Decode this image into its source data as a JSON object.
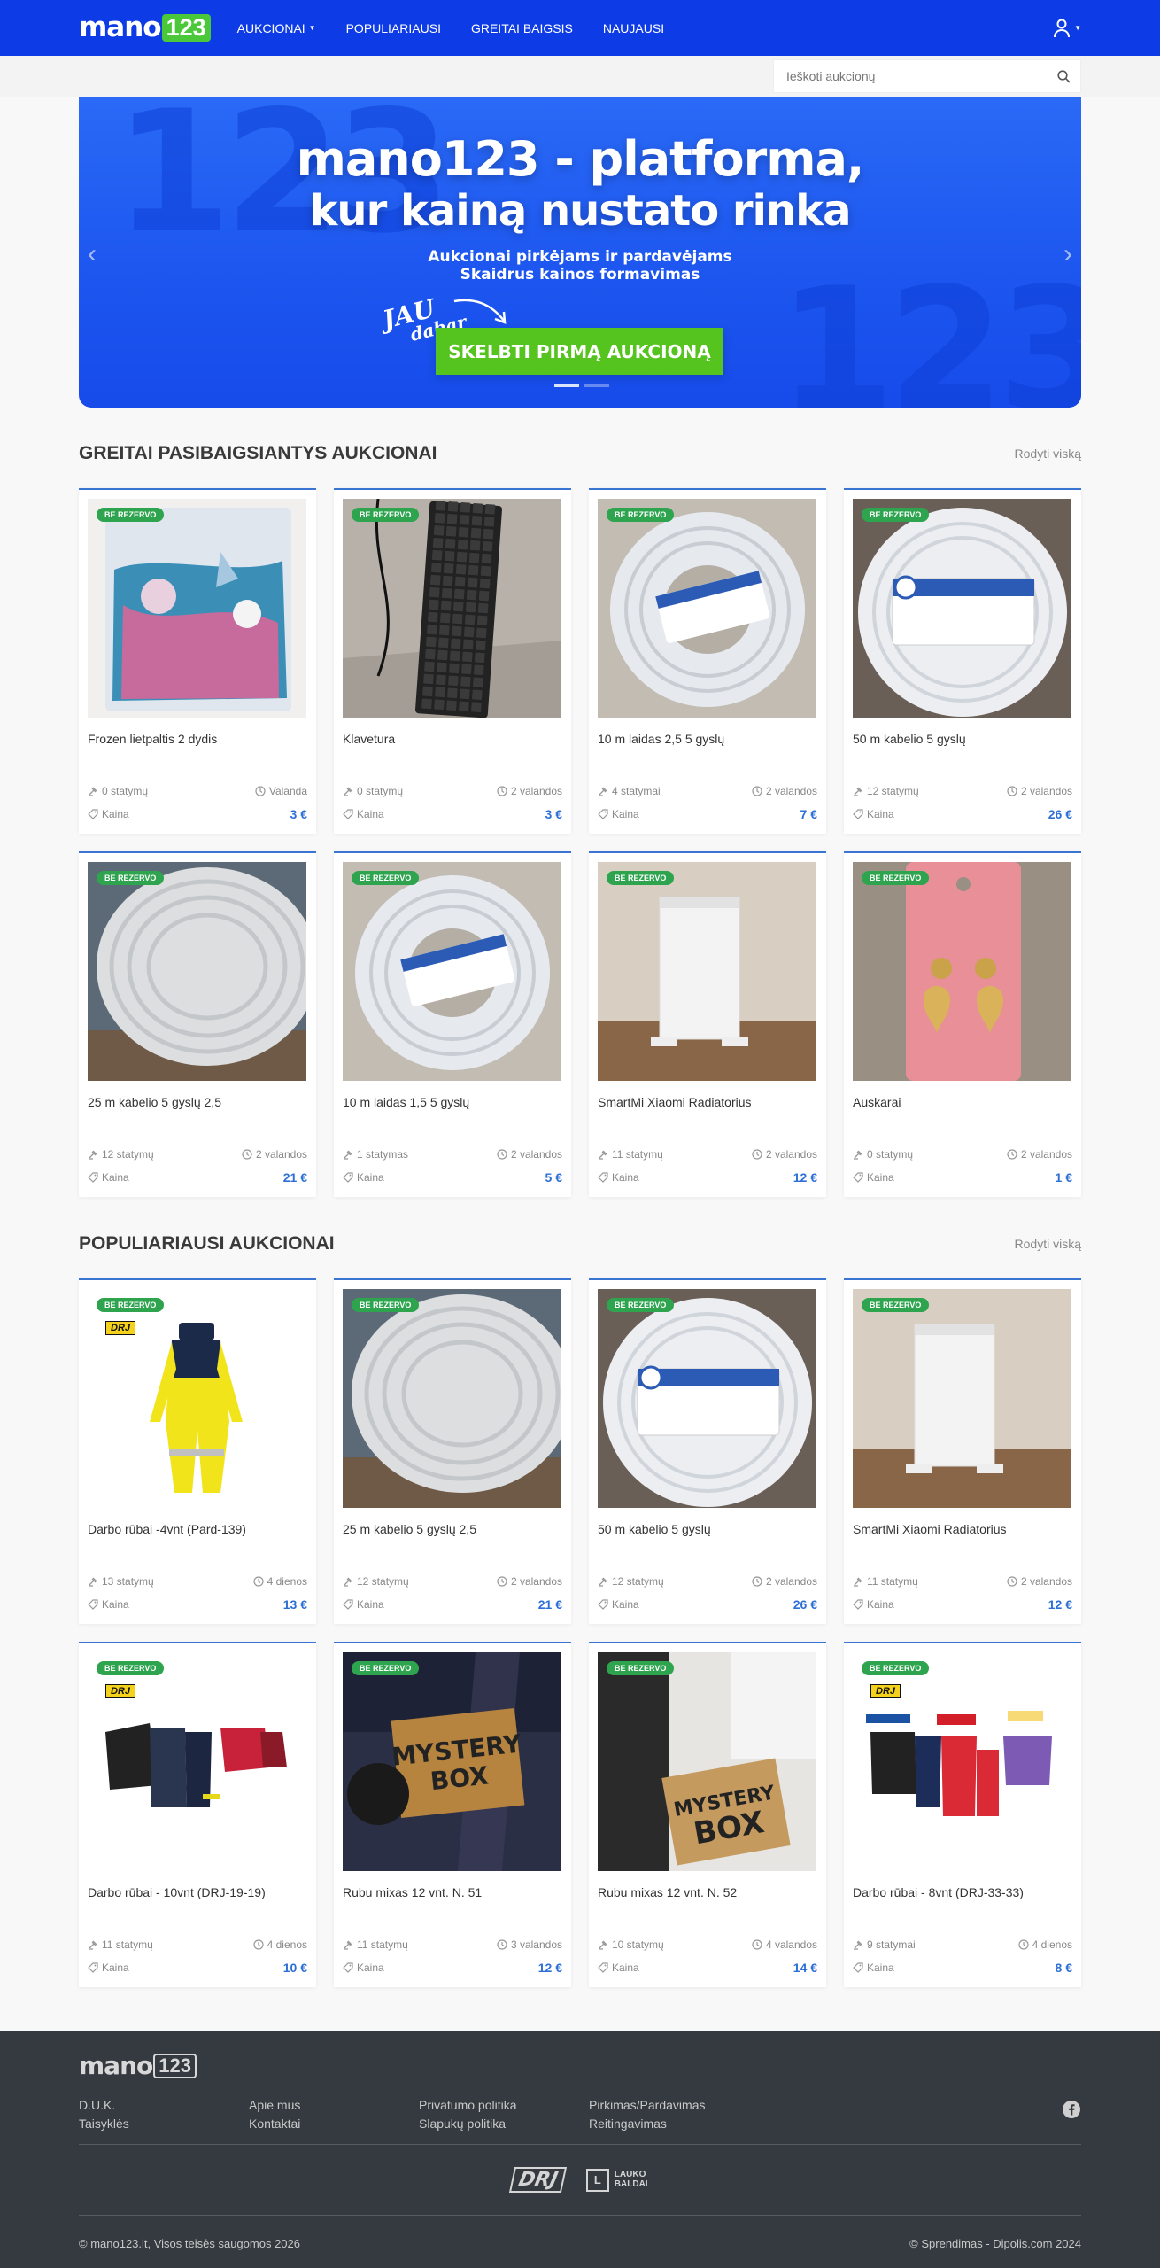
{
  "nav": {
    "logo_word": "mano",
    "logo_num": "123",
    "links": [
      "AUKCIONAI",
      "POPULIARIAUSI",
      "GREITAI BAIGSIS",
      "NAUJAUSI"
    ]
  },
  "search": {
    "placeholder": "Ieškoti aukcionų"
  },
  "hero": {
    "title_line1": "mano123 - platforma,",
    "title_line2": "kur kainą nustato rinka",
    "sub_line1": "Aukcionai pirkėjams ir pardavėjams",
    "sub_line2": "Skaidrus kainos formavimas",
    "script_line1": "JAU",
    "script_line2": "dabar",
    "cta": "SKELBTI PIRMĄ AUKCIONĄ",
    "bg_number": "123",
    "slide_active": 1
  },
  "badge_label": "BE REZERVO",
  "price_label": "Kaina",
  "sections": [
    {
      "title": "GREITAI PASIBAIGSIANTYS AUKCIONAI",
      "link": "Rodyti viską",
      "items": [
        {
          "title": "Frozen lietpaltis 2 dydis",
          "bids": "0 statymų",
          "time": "Valanda",
          "price": "3 €",
          "img": "frozen"
        },
        {
          "title": "Klavetura",
          "bids": "0 statymų",
          "time": "2 valandos",
          "price": "3 €",
          "img": "keyboard"
        },
        {
          "title": "10 m laidas 2,5 5 gyslų",
          "bids": "4 statymai",
          "time": "2 valandos",
          "price": "7 €",
          "img": "cable-blue"
        },
        {
          "title": "50 m kabelio 5 gyslų",
          "bids": "12 statymų",
          "time": "2 valandos",
          "price": "26 €",
          "img": "cable-white"
        },
        {
          "title": "25 m kabelio 5 gyslų 2,5",
          "bids": "12 statymų",
          "time": "2 valandos",
          "price": "21 €",
          "img": "cable-wrap"
        },
        {
          "title": "10 m laidas 1,5 5 gyslų",
          "bids": "1 statymas",
          "time": "2 valandos",
          "price": "5 €",
          "img": "cable-blue"
        },
        {
          "title": "SmartMi Xiaomi Radiatorius",
          "bids": "11 statymų",
          "time": "2 valandos",
          "price": "12 €",
          "img": "radiator"
        },
        {
          "title": "Auskarai",
          "bids": "0 statymų",
          "time": "2 valandos",
          "price": "1 €",
          "img": "earrings"
        }
      ]
    },
    {
      "title": "POPULIARIAUSI AUKCIONAI",
      "link": "Rodyti viską",
      "items": [
        {
          "title": "Darbo rūbai -4vnt (Pard-139)",
          "bids": "13 statymų",
          "time": "4 dienos",
          "price": "13 €",
          "img": "workwear-yellow"
        },
        {
          "title": "25 m kabelio 5 gyslų 2,5",
          "bids": "12 statymų",
          "time": "2 valandos",
          "price": "21 €",
          "img": "cable-wrap"
        },
        {
          "title": "50 m kabelio 5 gyslų",
          "bids": "12 statymų",
          "time": "2 valandos",
          "price": "26 €",
          "img": "cable-white"
        },
        {
          "title": "SmartMi Xiaomi Radiatorius",
          "bids": "11 statymų",
          "time": "2 valandos",
          "price": "12 €",
          "img": "radiator"
        },
        {
          "title": "Darbo rūbai - 10vnt (DRJ-19-19)",
          "bids": "11 statymų",
          "time": "4 dienos",
          "price": "10 €",
          "img": "workwear-set"
        },
        {
          "title": "Rubu mixas 12 vnt. N. 51",
          "bids": "11 statymų",
          "time": "3 valandos",
          "price": "12 €",
          "img": "mystery1"
        },
        {
          "title": "Rubu mixas 12 vnt. N. 52",
          "bids": "10 statymų",
          "time": "4 valandos",
          "price": "14 €",
          "img": "mystery2"
        },
        {
          "title": "Darbo rūbai - 8vnt (DRJ-33-33)",
          "bids": "9 statymai",
          "time": "4 dienos",
          "price": "8 €",
          "img": "workwear-brands"
        }
      ]
    }
  ],
  "footer": {
    "logo_word": "mano",
    "logo_num": "123",
    "columns": [
      [
        "D.U.K.",
        "Taisyklės"
      ],
      [
        "Apie mus",
        "Kontaktai"
      ],
      [
        "Privatumo politika",
        "Slapukų politika"
      ],
      [
        "Pirkimas/Pardavimas",
        "Reitingavimas"
      ]
    ],
    "partner1": "DRJ",
    "partner2_line1": "LAUKO",
    "partner2_line2": "BALDAI",
    "copyright": "© mano123.lt, Visos teisės saugomos 2026",
    "credit": "© Sprendimas - Dipolis.com 2024"
  },
  "colors": {
    "nav": "#0d3ce6",
    "accent": "#2d6fd6",
    "badge": "#2ea44f",
    "cta": "#56c41f",
    "footer": "#343a40"
  }
}
